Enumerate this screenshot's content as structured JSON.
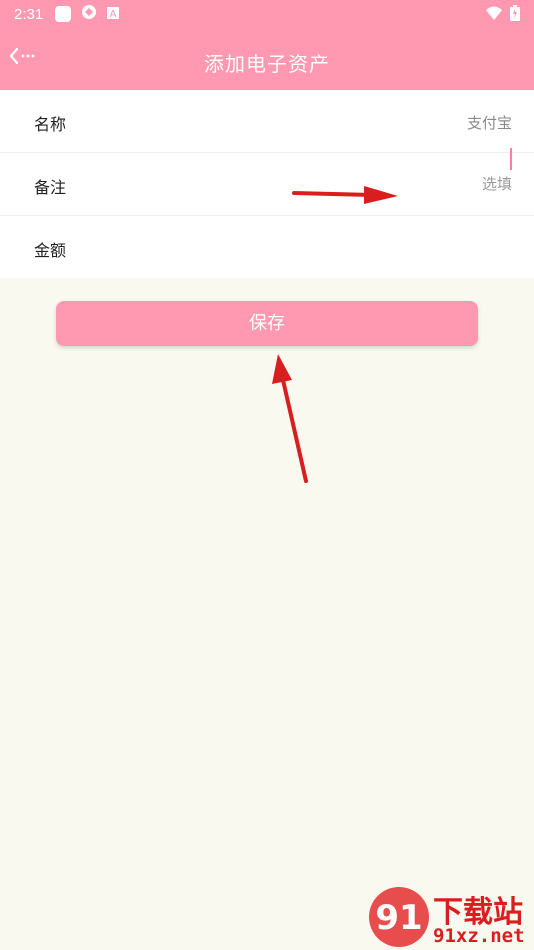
{
  "status_bar": {
    "time": "2:31",
    "icons": [
      "app-square-icon",
      "app-logo-icon",
      "keyboard-a-icon",
      "wifi-icon",
      "battery-icon"
    ]
  },
  "title_bar": {
    "back_icon": "back-chevron-icon",
    "title": "添加电子资产"
  },
  "form": {
    "rows": [
      {
        "label": "名称",
        "value": "支付宝"
      },
      {
        "label": "备注",
        "placeholder": "选填",
        "value": ""
      },
      {
        "label": "金额",
        "value": ""
      }
    ]
  },
  "save_button": {
    "label": "保存"
  },
  "watermark": {
    "brand": "下载站",
    "domain": "91xz.net",
    "logo_text": "91"
  },
  "colors": {
    "brand_pink": "#FF98B0",
    "page_bg": "#FAF9F0",
    "annotation_arrow": "#D81E1E"
  }
}
